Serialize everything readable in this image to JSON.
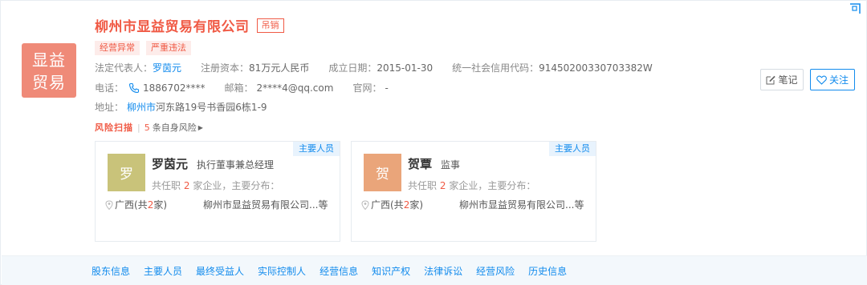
{
  "company": {
    "logo_line1": "显益",
    "logo_line2": "贸易",
    "name": "柳州市显益贸易有限公司",
    "status": "吊销",
    "tags": [
      "经营异常",
      "严重违法"
    ],
    "legal_rep_label": "法定代表人：",
    "legal_rep": "罗茵元",
    "capital_label": "注册资本：",
    "capital": "81万元人民币",
    "founded_label": "成立日期：",
    "founded": "2015-01-30",
    "credit_code_label": "统一社会信用代码：",
    "credit_code": "91450200330703382W",
    "phone_label": "电话：",
    "phone": "1886702****",
    "email_label": "邮箱：",
    "email": "2****4@qq.com",
    "website_label": "官网：",
    "website": "-",
    "address_label": "地址：",
    "address_link": "柳州市",
    "address_rest": "河东路19号书香园6栋1-9"
  },
  "risk": {
    "label": "风险扫描",
    "count": "5",
    "text": "条自身风险"
  },
  "actions": {
    "note": "笔记",
    "follow": "关注"
  },
  "people": [
    {
      "avatar_char": "罗",
      "avatar_color": "#c9c37a",
      "name": "罗茵元",
      "title": "执行董事兼总经理",
      "role": "主要人员",
      "count_prefix": "共任职",
      "count": "2",
      "count_suffix": "家企业，主要分布：",
      "region_prefix": "广西(共",
      "region_count": "2",
      "region_suffix": "家)",
      "company": "柳州市显益贸易有限公司...等"
    },
    {
      "avatar_char": "贺",
      "avatar_color": "#eaa57a",
      "name": "贺覃",
      "title": "监事",
      "role": "主要人员",
      "count_prefix": "共任职",
      "count": "2",
      "count_suffix": "家企业，主要分布：",
      "region_prefix": "广西(共",
      "region_count": "2",
      "region_suffix": "家)",
      "company": "柳州市显益贸易有限公司...等"
    }
  ],
  "nav": [
    "股东信息",
    "主要人员",
    "最终受益人",
    "实际控制人",
    "经营信息",
    "知识产权",
    "法律诉讼",
    "经营风险",
    "历史信息"
  ],
  "colors": {
    "accent_red": "#f05a45",
    "accent_blue": "#128bed",
    "logo_bg": "#ef8a78"
  }
}
